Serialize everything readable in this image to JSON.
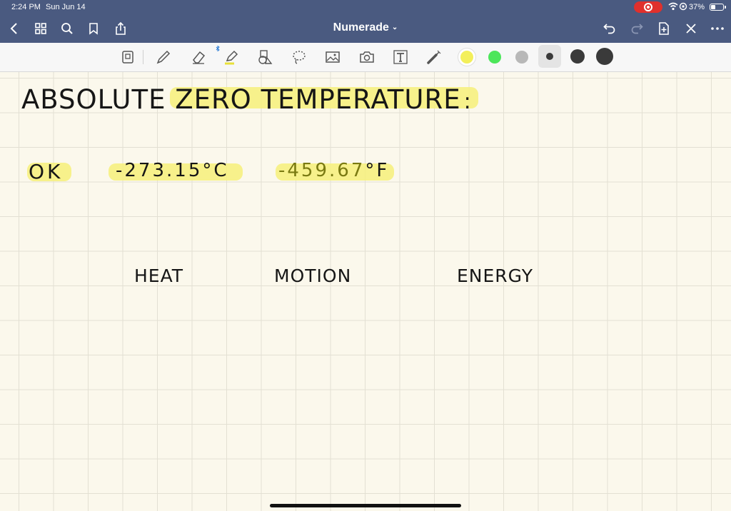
{
  "status": {
    "time": "2:24 PM",
    "date": "Sun Jun 14",
    "battery": "37%"
  },
  "nav": {
    "title": "Numerade",
    "title_caret": "⌄"
  },
  "toolbar": {
    "tools": [
      "page-view-icon",
      "pen-icon",
      "eraser-icon",
      "highlighter-icon",
      "shapes-icon",
      "lasso-icon",
      "image-icon",
      "camera-icon",
      "text-icon",
      "laser-pointer-icon"
    ],
    "colors": [
      "#f3ef5a",
      "#4ce65a",
      "#b8b8b8"
    ],
    "sizes": [
      "small",
      "medium",
      "large"
    ]
  },
  "notes": {
    "title": "ABSOLUTE ZERO TEMPERATURE",
    "title_colon": ":",
    "kelvin": "OK",
    "celsius": "-273.15°C",
    "fahrenheit_value": "-459.67",
    "fahrenheit_unit": "°F",
    "words": [
      "HEAT",
      "MOTION",
      "ENERGY"
    ]
  },
  "colors": {
    "nav_bg": "#4a5a80",
    "highlight": "#f6f07a",
    "paper": "#fbf8ec",
    "record": "#e0302c"
  }
}
